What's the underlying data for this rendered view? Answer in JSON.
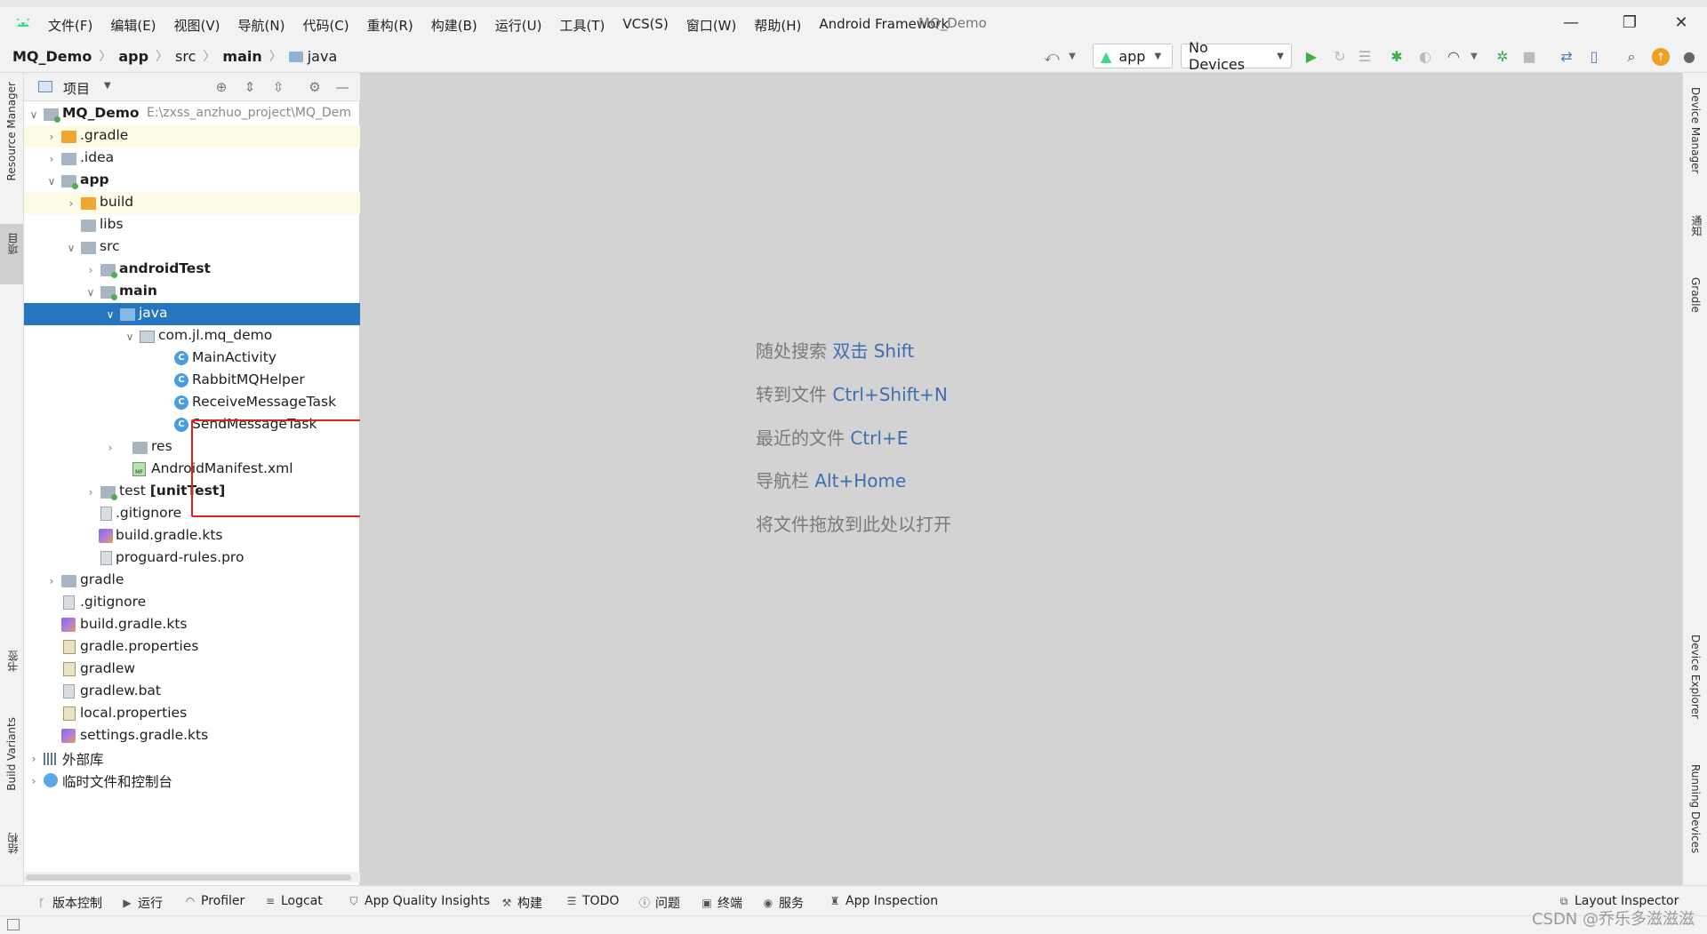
{
  "window": {
    "menus": [
      "文件(F)",
      "编辑(E)",
      "视图(V)",
      "导航(N)",
      "代码(C)",
      "重构(R)",
      "构建(B)",
      "运行(U)",
      "工具(T)",
      "VCS(S)",
      "窗口(W)",
      "帮助(H)",
      "Android Framework"
    ],
    "title": "MQ_Demo"
  },
  "breadcrumb": [
    "MQ_Demo",
    "app",
    "src",
    "main",
    "java"
  ],
  "toolbar": {
    "run_config": "app",
    "device": "No Devices"
  },
  "project_panel": {
    "title": "项目",
    "tree": [
      {
        "label": "MQ_Demo",
        "hint": "E:\\zxss_anzhuo_project\\MQ_Dem",
        "bold": true
      },
      {
        "label": ".gradle"
      },
      {
        "label": ".idea"
      },
      {
        "label": "app",
        "bold": true
      },
      {
        "label": "build"
      },
      {
        "label": "libs"
      },
      {
        "label": "src"
      },
      {
        "label": "androidTest",
        "bold": true
      },
      {
        "label": "main",
        "bold": true
      },
      {
        "label": "java"
      },
      {
        "label": "com.jl.mq_demo"
      },
      {
        "label": "MainActivity"
      },
      {
        "label": "RabbitMQHelper"
      },
      {
        "label": "ReceiveMessageTask"
      },
      {
        "label": "SendMessageTask"
      },
      {
        "label": "res"
      },
      {
        "label": "AndroidManifest.xml"
      },
      {
        "label": "test",
        "suffix": "[unitTest]"
      },
      {
        "label": ".gitignore"
      },
      {
        "label": "build.gradle.kts"
      },
      {
        "label": "proguard-rules.pro"
      },
      {
        "label": "gradle"
      },
      {
        "label": ".gitignore"
      },
      {
        "label": "build.gradle.kts"
      },
      {
        "label": "gradle.properties"
      },
      {
        "label": "gradlew"
      },
      {
        "label": "gradlew.bat"
      },
      {
        "label": "local.properties"
      },
      {
        "label": "settings.gradle.kts"
      },
      {
        "label": "外部库"
      },
      {
        "label": "临时文件和控制台"
      }
    ]
  },
  "editor_tips": [
    {
      "text": "随处搜索 ",
      "key": "双击 Shift"
    },
    {
      "text": "转到文件 ",
      "key": "Ctrl+Shift+N"
    },
    {
      "text": "最近的文件 ",
      "key": "Ctrl+E"
    },
    {
      "text": "导航栏 ",
      "key": "Alt+Home"
    },
    {
      "text": "将文件拖放到此处以打开",
      "key": ""
    }
  ],
  "left_strip": [
    "Resource Manager",
    "项目",
    "书签",
    "Build Variants",
    "结构"
  ],
  "right_strip": [
    "Device Manager",
    "通知",
    "Gradle",
    "Device Explorer",
    "Running Devices"
  ],
  "bottom_tools": [
    "版本控制",
    "运行",
    "Profiler",
    "Logcat",
    "App Quality Insights",
    "构建",
    "TODO",
    "问题",
    "终端",
    "服务",
    "App Inspection"
  ],
  "bottom_right_tool": "Layout Inspector",
  "watermark": "CSDN @乔乐多滋滋滋"
}
